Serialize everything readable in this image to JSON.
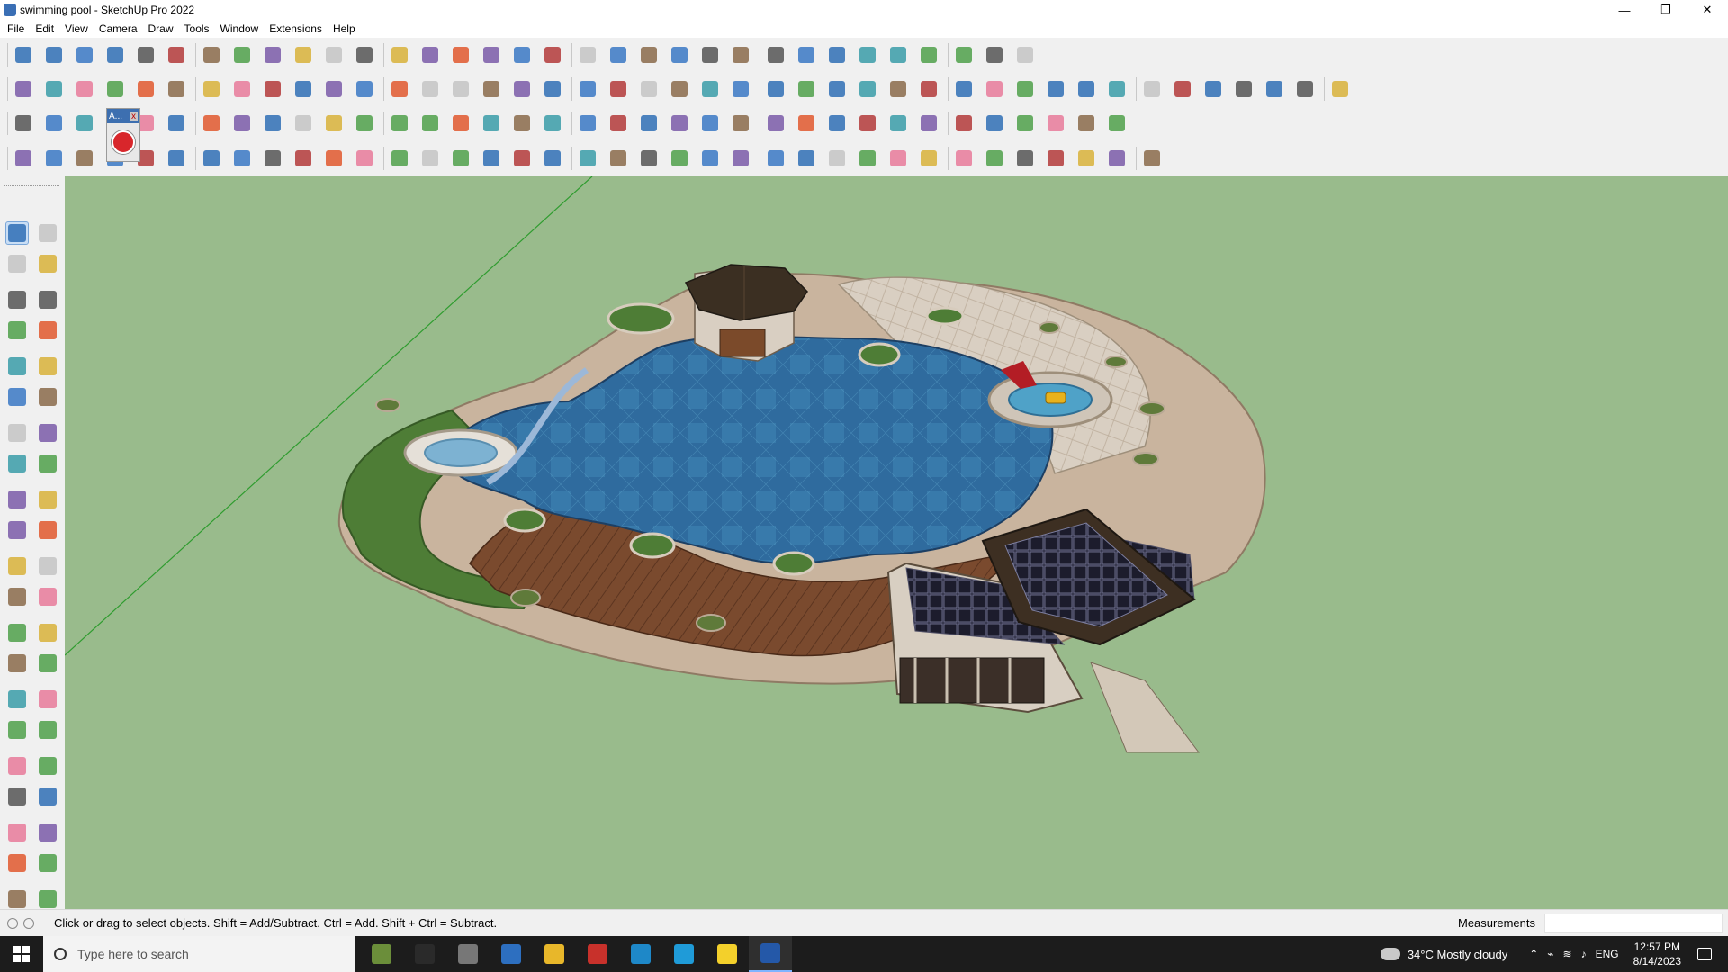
{
  "window": {
    "title": "swimming pool - SketchUp Pro 2022",
    "minimize_label": "—",
    "restore_label": "❐",
    "close_label": "✕"
  },
  "menu": [
    "File",
    "Edit",
    "View",
    "Camera",
    "Draw",
    "Tools",
    "Window",
    "Extensions",
    "Help"
  ],
  "toolbar_rows": [
    {
      "name": "toolbar-row-1",
      "tools": [
        "search-icon",
        "select-tool-icon",
        "eraser-icon",
        "line-tool-icon",
        "freehand-tool-icon",
        "paint-bucket-icon",
        "pushpull-icon",
        "follow-me-icon",
        "move-icon",
        "rotate-icon",
        "scale-icon",
        "tape-measure-icon",
        "text-tool-icon",
        "paint-icon",
        "orbit-icon",
        "pan-icon",
        "zoom-icon",
        "zoom-extents-icon",
        "warehouse-icon",
        "extension-warehouse-icon",
        "layout-icon",
        "extension-manager-icon",
        "profile-icon",
        "component-icon",
        "group-icon",
        "section-plane-icon",
        "flip-icon",
        "sort-icon",
        "dimension-icon",
        "solid-tools-icon",
        "undo-icon",
        "redo-icon",
        "trimble-icon"
      ]
    },
    {
      "name": "toolbar-row-2",
      "tools": [
        "box-icon",
        "intersect-icon",
        "union-icon",
        "push-icon",
        "axis-x-icon",
        "axis-y-icon",
        "axis-z-icon",
        "axis-n-icon",
        "axis-r-icon",
        "axis-f-icon",
        "curve-icon",
        "shadow-icon",
        "shadow-alt-icon",
        "shadow-alt2-icon",
        "face-icon",
        "face-alt-icon",
        "house-front-icon",
        "house-side-icon",
        "house-icon",
        "house-outline-icon",
        "house-roof-icon",
        "fx-icon",
        "dashed-icon",
        "pencil-icon",
        "rectangle-icon",
        "circle-icon",
        "polygon-icon",
        "ellipse-icon",
        "parallelogram-icon",
        "arc-icon",
        "pie-icon",
        "bezier-icon",
        "lasso-icon",
        "spiral-icon",
        "paint-knife-icon",
        "eraser-pink-icon",
        "soften-icon",
        "texture-icon",
        "sandbox-icon",
        "sandbox-alt-icon",
        "drape-icon",
        "flip-edge-icon",
        "smoove-icon"
      ]
    },
    {
      "name": "toolbar-row-3",
      "tools": [
        "blue-square-icon",
        "diamond-icon",
        "plane-icon",
        "red-book-icon",
        "layers-icon",
        "spiral-orange-icon",
        "red-box-icon",
        "stack-icon",
        "page-icon",
        "box-3d-icon",
        "chain-icon",
        "curve-lines-icon",
        "dots-icon",
        "cross-red-icon",
        "cross-green-icon",
        "cross-blue-icon",
        "cone-icon",
        "fountain-icon",
        "triangle-icon",
        "loop-icon",
        "knot-icon",
        "cog-icon",
        "star-icon",
        "cup-icon",
        "magnet-icon",
        "puzzle-icon",
        "puzzle-alt-icon",
        "gear-red-icon",
        "gem-icon",
        "monitor-icon",
        "grid-orange-icon",
        "grid-yellow-icon",
        "grid-tan-icon",
        "scatter-icon",
        "curve-dots-icon",
        "layout-grid-icon"
      ]
    },
    {
      "name": "toolbar-row-4",
      "tools": [
        "node-edit-icon",
        "curve-edit-icon",
        "red-shape-icon",
        "rotate3d-icon",
        "path-icon",
        "pipe-icon",
        "cube-open-icon",
        "ball-icon",
        "spring-icon",
        "angle-icon",
        "corner-icon",
        "line-red-icon",
        "arc-red-icon",
        "frame-icon",
        "wedge-icon",
        "column-icon",
        "comb-icon",
        "hand-icon",
        "leaf-icon",
        "star-plane-icon",
        "stairs-icon",
        "ramp-icon",
        "railing-icon",
        "bars-icon",
        "fence-icon",
        "cylinder-icon",
        "layers-alt-icon",
        "stairs-alt-icon",
        "plane-alt-icon",
        "checker-icon",
        "columns-icon",
        "ladder-icon",
        "sphere-icon",
        "spiky-icon",
        "ramp-alt-icon",
        "tree-icon",
        "gem-outline-icon"
      ]
    }
  ],
  "floating_panel": {
    "label": "A...",
    "close": "x"
  },
  "left_tools": [
    "select-icon",
    "orbit-hand-icon",
    "paint-icon",
    "eraser-icon",
    "component-icon",
    "tape-icon",
    "line-icon",
    "freehand-icon",
    "rectangle-icon",
    "rotated-rect-icon",
    "circle-icon",
    "polygon-icon",
    "arc-icon",
    "arc-2pt-icon",
    "pie-icon",
    "arc-3pt-icon",
    "move-icon",
    "pushpull-icon",
    "rotate-icon",
    "followme-icon",
    "scale-icon",
    "offset-icon",
    "tape-measure-icon",
    "dimension-icon",
    "protractor-icon",
    "text-icon",
    "axes-icon",
    "3d-text-icon",
    "orbit-icon",
    "pan-icon",
    "zoom-icon",
    "zoom-window-icon",
    "zoom-extents-icon",
    "previous-view-icon",
    "position-camera-icon",
    "look-around-icon",
    "walk-icon",
    "section-icon",
    "warehouse-icon",
    "sandbox-icon",
    "layers-icon",
    "extension-icon"
  ],
  "statusbar": {
    "hint": "Click or drag to select objects. Shift = Add/Subtract. Ctrl = Add. Shift + Ctrl = Subtract.",
    "measurements_label": "Measurements",
    "measurements_value": ""
  },
  "taskbar": {
    "search_placeholder": "Type here to search",
    "apps": [
      "minecraft-icon",
      "headset-icon",
      "task-view-icon",
      "calculator-icon",
      "file-explorer-icon",
      "acrobat-icon",
      "app-blue-icon",
      "edge-icon",
      "sticky-notes-icon",
      "sketchup-icon"
    ],
    "weather": "34°C  Mostly cloudy",
    "language": "ENG",
    "time": "12:57 PM",
    "date": "8/14/2023"
  },
  "colors": {
    "viewport_bg": "#99bb8c",
    "water": "#2f6b9e",
    "deck_wood": "#7a4a2e",
    "stone": "#d9cfc2",
    "grass": "#4e7d36",
    "gazebo_roof": "#3b2f22",
    "axis_green": "#2f9c2f"
  }
}
